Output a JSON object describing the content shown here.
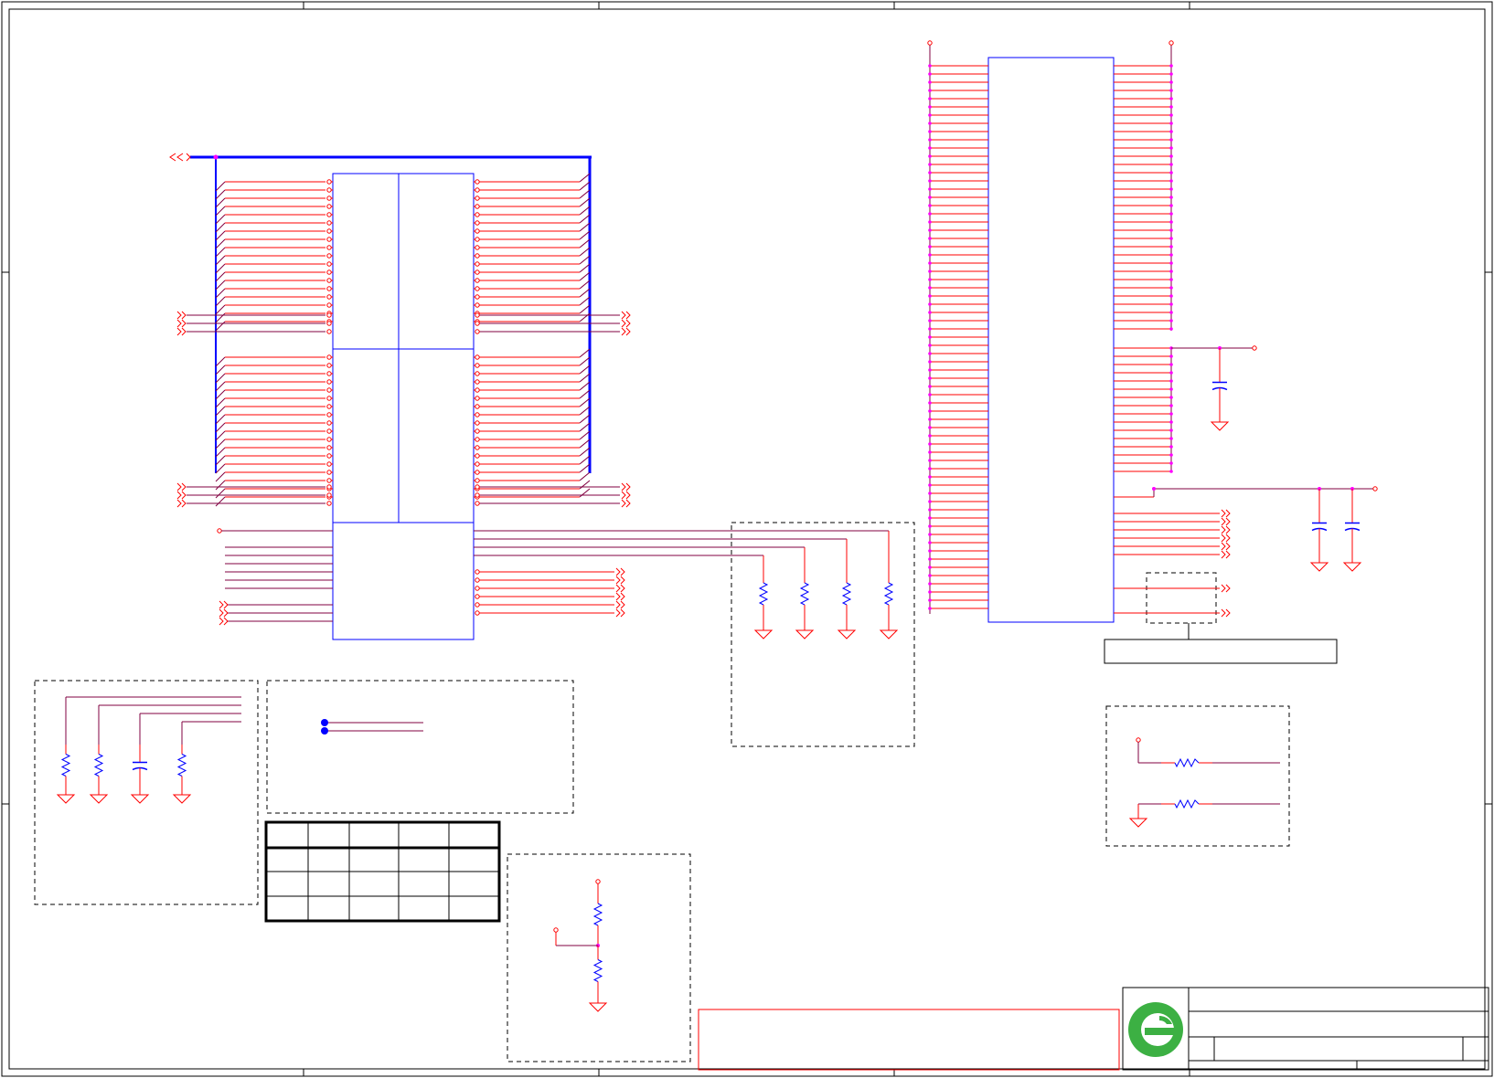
{
  "sheet": {
    "title": "",
    "columns": [
      "",
      "",
      "",
      "",
      ""
    ],
    "rows": [
      "",
      "",
      "",
      ""
    ]
  },
  "config_table": {
    "rows": [
      [
        "",
        "",
        "",
        "",
        ""
      ],
      [
        "",
        "",
        "",
        "",
        ""
      ],
      [
        "",
        "",
        "",
        "",
        ""
      ]
    ]
  },
  "title_block": {
    "company": "",
    "title": "",
    "sheet_number": "",
    "revision": ""
  },
  "notes": {
    "red_box": ""
  },
  "colors": {
    "wire": "#ff0000",
    "net": "#800040",
    "component": "#0000ff",
    "bus": "#0000ff",
    "junction": "#ff00ff",
    "border": "#000000",
    "logo": "#3cb043"
  },
  "icons": {
    "logo": "company-logo-icon",
    "ground": "ground-icon",
    "resistor": "resistor-icon",
    "capacitor": "capacitor-icon",
    "offpage": "offpage-connector-icon"
  }
}
